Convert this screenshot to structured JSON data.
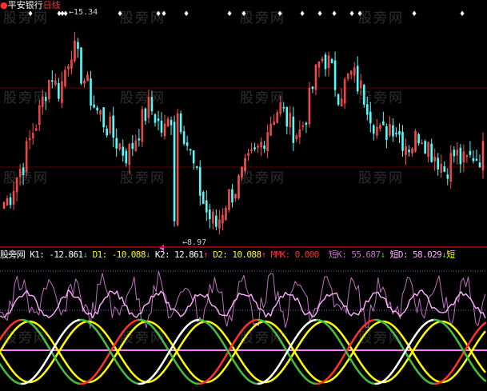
{
  "header": {
    "stock_name": "平安银行",
    "period": "日线",
    "high_label": "15.34",
    "low_label": "8.97"
  },
  "indicator": {
    "name": "股旁网",
    "k1_label": "K1:",
    "k1_value": "-12.861",
    "d1_label": "D1:",
    "d1_value": "-10.088",
    "k2_label": "K2:",
    "k2_value": "12.861",
    "d2_label": "D2:",
    "d2_value": "10.088",
    "mmk_label": "MMK:",
    "mmk_value": "0.000",
    "dk_label": "短K:",
    "dk_value": "55.687",
    "dd_label": "短D:",
    "dd_value": "58.029",
    "trailing": "短"
  },
  "watermark": "股旁网",
  "colors": {
    "background": "#000000",
    "up": "#ff5050",
    "down": "#54fcfc",
    "separator": "#c00000",
    "k_line": "#ffffff",
    "d_line": "#ffff00",
    "red_line": "#ff3030",
    "green_line": "#40c040",
    "purple_line": "#c070c0",
    "pink_line": "#ffb0ff",
    "signal_marker": "#ffffff"
  },
  "chart_data": [
    {
      "type": "candlestick",
      "title": "平安银行 日线",
      "ylim": [
        8.5,
        16.2
      ],
      "high": 15.34,
      "low": 8.97,
      "note_values": "price path traced from screenshot (approximate)",
      "closes": [
        9.9,
        10.0,
        10.5,
        10.9,
        11.2,
        11.8,
        12.3,
        12.7,
        13.3,
        13.9,
        14.2,
        13.6,
        13.9,
        14.6,
        15.1,
        14.8,
        14.2,
        13.9,
        13.4,
        13.0,
        12.8,
        12.5,
        12.3,
        12.0,
        11.8,
        11.5,
        11.6,
        12.0,
        12.4,
        12.8,
        13.1,
        12.9,
        12.5,
        12.2,
        12.6,
        13.0,
        12.9,
        12.4,
        11.8,
        11.2,
        10.6,
        10.0,
        9.5,
        9.3,
        9.1,
        9.6,
        10.0,
        10.2,
        10.4,
        10.7,
        11.0,
        11.3,
        11.5,
        11.8,
        12.2,
        12.6,
        12.9,
        13.1,
        12.8,
        12.5,
        12.3,
        12.2,
        12.6,
        13.2,
        13.9,
        14.5,
        14.8,
        14.6,
        14.1,
        13.6,
        13.7,
        14.0,
        14.2,
        13.9,
        13.6,
        13.3,
        12.8,
        12.4,
        12.1,
        12.3,
        12.6,
        12.4,
        12.1,
        11.9,
        11.8,
        12.0,
        12.3,
        12.0,
        11.7,
        11.5,
        11.3,
        11.0,
        11.2,
        11.5,
        11.4,
        11.2,
        11.3,
        11.5,
        11.4,
        11.6
      ],
      "signal_markers": 17
    },
    {
      "type": "line",
      "title": "股旁网",
      "series": [
        {
          "name": "K1",
          "last": -12.861
        },
        {
          "name": "D1",
          "last": -10.088
        },
        {
          "name": "K2",
          "last": 12.861
        },
        {
          "name": "D2",
          "last": 10.088
        },
        {
          "name": "MMK",
          "last": 0.0
        },
        {
          "name": "短K",
          "last": 55.687
        },
        {
          "name": "短D",
          "last": 58.029
        }
      ]
    }
  ]
}
